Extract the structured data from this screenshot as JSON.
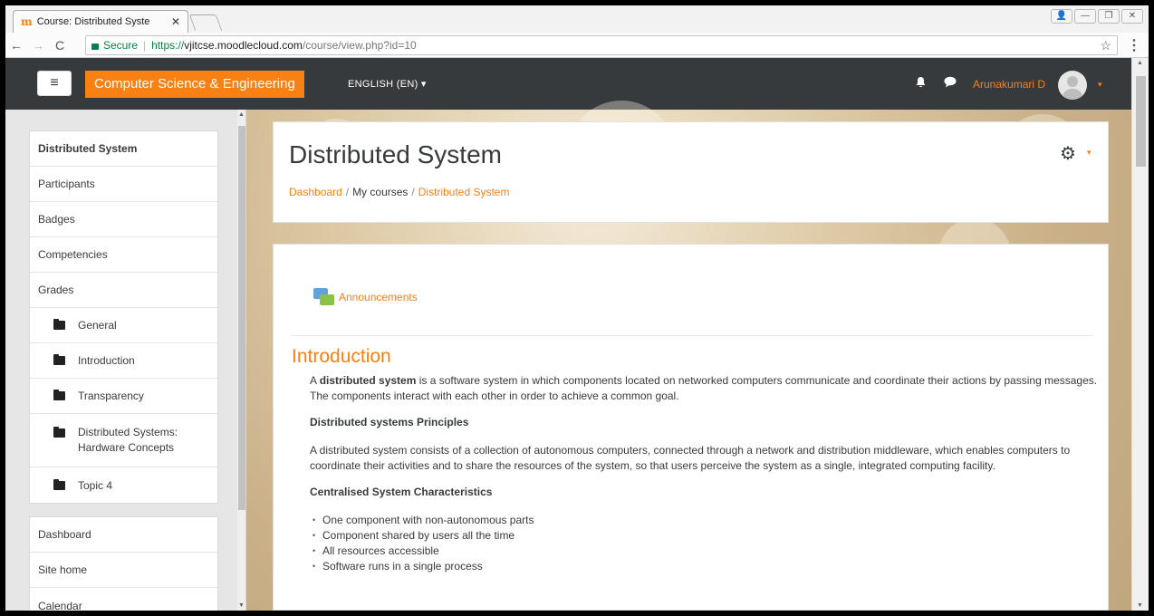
{
  "browser": {
    "tab_title": "Course: Distributed Syste",
    "tab_close": "✕",
    "favicon": "m",
    "secure_label": "Secure",
    "url_scheme": "https://",
    "url_host": "vjitcse.moodlecloud.com",
    "url_path": "/course/view.php?id=10",
    "back_icon": "←",
    "forward_icon": "→",
    "reload_icon": "C",
    "star_icon": "☆",
    "menu_icon": "⋮",
    "win_user": "👤",
    "win_min": "—",
    "win_restore": "❐",
    "win_close": "✕"
  },
  "navbar": {
    "menu_icon": "≡",
    "site_name": "Computer Science & Engineering",
    "language": "ENGLISH (EN) ▾",
    "bell_icon": "🔔",
    "chat_icon": "💬",
    "user_name": "Arunakumari D",
    "user_caret": "▾",
    "accent": "#f98012",
    "bg": "#373a3c"
  },
  "drawer": {
    "course_items": [
      {
        "label": "Distributed System"
      },
      {
        "label": "Participants"
      },
      {
        "label": "Badges"
      },
      {
        "label": "Competencies"
      },
      {
        "label": "Grades"
      }
    ],
    "sections": [
      {
        "label": "General"
      },
      {
        "label": "Introduction"
      },
      {
        "label": "Transparency"
      },
      {
        "label": "Distributed Systems: Hardware Concepts"
      },
      {
        "label": "Topic 4"
      }
    ],
    "site_items": [
      {
        "label": "Dashboard"
      },
      {
        "label": "Site home"
      },
      {
        "label": "Calendar"
      }
    ]
  },
  "header": {
    "title": "Distributed System",
    "breadcrumb": [
      "Dashboard",
      "My courses",
      "Distributed System"
    ],
    "breadcrumb_sep": "/",
    "cog_icon": "⚙",
    "cog_caret": "▾"
  },
  "main": {
    "announcements": "Announcements",
    "section_title": "Introduction",
    "intro_bold": "distributed system",
    "intro_prefix": "A ",
    "intro_rest": " is a software system in which components located on networked computers communicate and coordinate their actions by passing messages. The components interact with each other in order to achieve a common goal.",
    "principles_heading": "Distributed systems Principles",
    "principles_text": "A distributed system consists of a collection of autonomous computers, connected through a network and distribution middleware, which enables computers to coordinate their activities and to share the resources of the system, so that users perceive the system as a single, integrated computing facility.",
    "centralised_heading": "Centralised System Characteristics",
    "bullets": [
      "One component with non-autonomous parts",
      "Component shared by users all the time",
      "All resources accessible",
      "Software runs in a single process"
    ]
  }
}
